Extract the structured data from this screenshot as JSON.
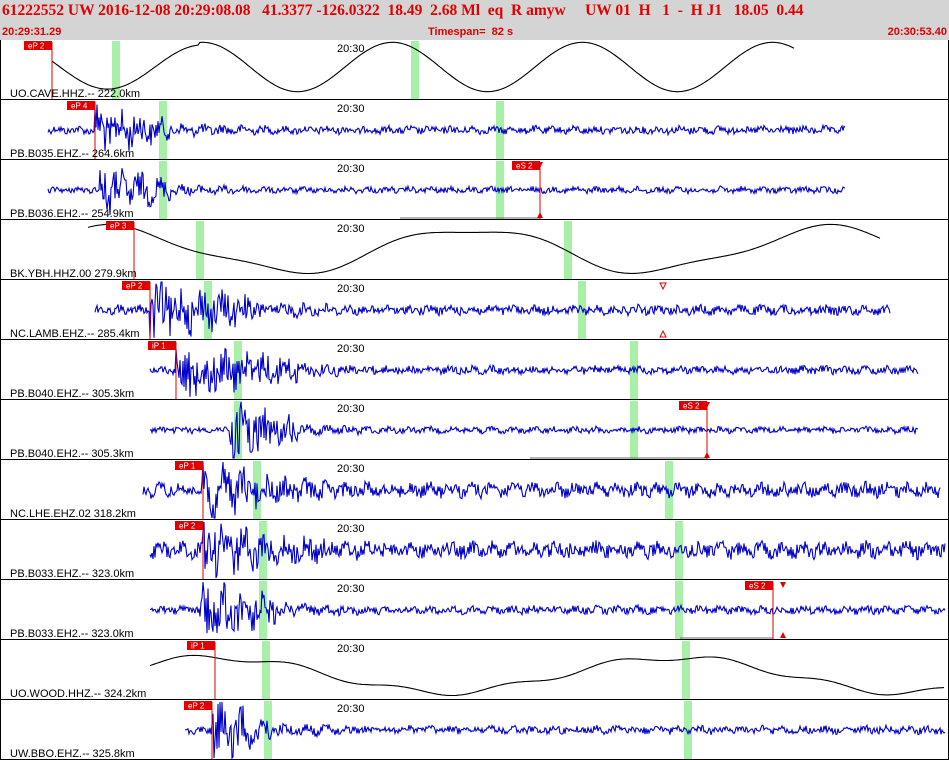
{
  "header": {
    "title_line": "61222552 UW 2016-12-08 20:29:08.08   41.3377 -126.0322  18.49  2.68 Ml  eq  R amyw     UW 01  H   1  -  H J1   18.05  0.44",
    "start_time": "20:29:31.29",
    "timespan": "Timespan=  82 s",
    "end_time": "20:30:53.40"
  },
  "colors": {
    "header_bg": "#d4d4d4",
    "header_text": "#e00000",
    "pick_flag": "#e00000",
    "trace_blue": "#0000cc",
    "trace_black": "#000000",
    "marker_green": "#a8f0a8"
  },
  "channels": [
    {
      "label": "UO.CAVE.HHZ.--  222.0km",
      "time_label": "20:30",
      "picks": [
        {
          "text": "eP 2"
        }
      ]
    },
    {
      "label": "PB.B035.EHZ.--  264.6km",
      "time_label": "20:30",
      "picks": [
        {
          "text": "eP 4"
        }
      ]
    },
    {
      "label": "PB.B036.EH2.--  254.9km",
      "time_label": "20:30",
      "picks": [
        {
          "text": "eS 2"
        }
      ]
    },
    {
      "label": "BK.YBH.HHZ.00  279.9km",
      "time_label": "20:30",
      "picks": [
        {
          "text": "eP 3"
        }
      ]
    },
    {
      "label": "NC.LAMB.EHZ.--  285.4km",
      "time_label": "20:30",
      "picks": [
        {
          "text": "eP 2"
        }
      ]
    },
    {
      "label": "PB.B040.EHZ.--  305.3km",
      "time_label": "20:30",
      "picks": [
        {
          "text": "iP 1"
        }
      ]
    },
    {
      "label": "PB.B040.EH2.--  305.3km",
      "time_label": "20:30",
      "picks": [
        {
          "text": "eS 2"
        }
      ]
    },
    {
      "label": "NC.LHE.EHZ.02  318.2km",
      "time_label": "20:30",
      "picks": [
        {
          "text": "eP 1"
        }
      ]
    },
    {
      "label": "PB.B033.EHZ.--  323.0km",
      "time_label": "20:30",
      "picks": [
        {
          "text": "eP 2"
        }
      ]
    },
    {
      "label": "PB.B033.EH2.--  323.0km",
      "time_label": "20:30",
      "picks": [
        {
          "text": "eS 2"
        }
      ]
    },
    {
      "label": "UO.WOOD.HHZ.--  324.2km",
      "time_label": "20:30",
      "picks": [
        {
          "text": "iP 1"
        }
      ]
    },
    {
      "label": "UW.BBO.EHZ.--  325.8km",
      "time_label": "20:30",
      "picks": [
        {
          "text": "eP 2"
        }
      ]
    }
  ]
}
